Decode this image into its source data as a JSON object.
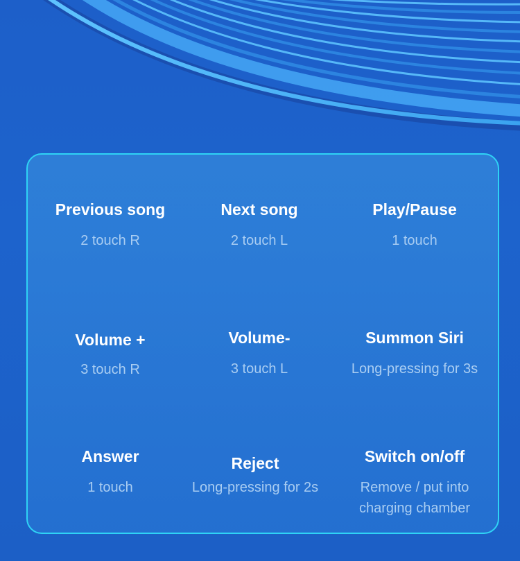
{
  "controls": [
    {
      "title": "Previous song",
      "action": "2 touch R"
    },
    {
      "title": "Next song",
      "action": "2 touch L"
    },
    {
      "title": "Play/Pause",
      "action": "1 touch"
    },
    {
      "title": "Volume +",
      "action": "3 touch R"
    },
    {
      "title": "Volume-",
      "action": "3 touch L"
    },
    {
      "title": "Summon Siri",
      "action": "Long-pressing for 3s"
    },
    {
      "title": "Answer",
      "action": "1 touch"
    },
    {
      "title": "Reject",
      "action": "Long-pressing for 2s"
    },
    {
      "title": "Switch on/off",
      "action": "Remove / put into",
      "action_line2": "charging chamber"
    }
  ],
  "colors": {
    "background": "#1d60c8",
    "panel_border": "#2fd3f5",
    "title": "#ffffff",
    "subtitle": "#a9cdf2"
  }
}
